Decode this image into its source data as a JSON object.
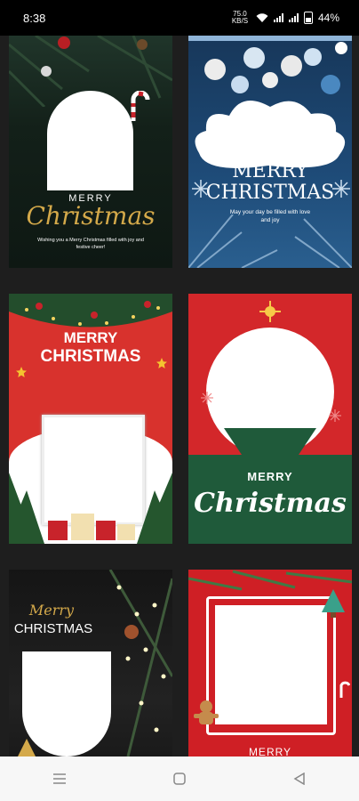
{
  "status_bar": {
    "time": "8:38",
    "speed": "75.0 KB/S",
    "battery": "44%"
  },
  "templates": [
    {
      "merry": "MERRY",
      "christmas": "Christmas",
      "wish": "Wishing you a Merry Christmas filled with joy and festive cheer!"
    },
    {
      "merry": "MERRY",
      "christmas": "CHRISTMAS",
      "wish": "May your day be filled with love and joy"
    },
    {
      "merry": "MERRY",
      "christmas": "CHRISTMAS"
    },
    {
      "merry": "MERRY",
      "christmas": "Christmas"
    },
    {
      "merry": "Merry",
      "christmas": "CHRISTMAS"
    },
    {
      "merry": "MERRY"
    }
  ],
  "nav": {
    "menu_icon": "menu-icon",
    "home_icon": "home-square-icon",
    "back_icon": "back-triangle-icon"
  },
  "colors": {
    "background": "#1e1e1e",
    "card_red": "#d3272a",
    "card_navy": "#1e4b78",
    "card_green": "#1f5a3a",
    "gold": "#d4a94a"
  }
}
